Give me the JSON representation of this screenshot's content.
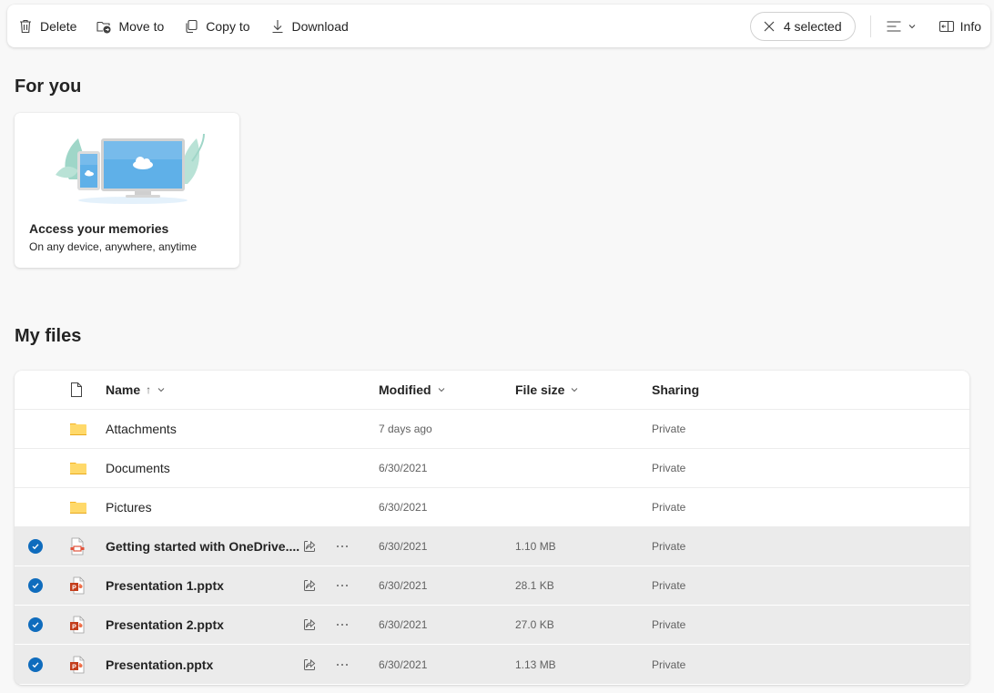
{
  "toolbar": {
    "delete_label": "Delete",
    "move_label": "Move to",
    "copy_label": "Copy to",
    "download_label": "Download",
    "selected_label": "4 selected",
    "info_label": "Info"
  },
  "for_you": {
    "title": "For you",
    "card": {
      "title": "Access your memories",
      "subtitle": "On any device, anywhere, anytime"
    }
  },
  "my_files": {
    "title": "My files",
    "columns": {
      "name": "Name",
      "sort_indicator": "↑",
      "modified": "Modified",
      "file_size": "File size",
      "sharing": "Sharing"
    },
    "rows": [
      {
        "name": "Attachments",
        "type": "folder",
        "modified": "7 days ago",
        "size": "",
        "sharing": "Private",
        "selected": false
      },
      {
        "name": "Documents",
        "type": "folder",
        "modified": "6/30/2021",
        "size": "",
        "sharing": "Private",
        "selected": false
      },
      {
        "name": "Pictures",
        "type": "folder",
        "modified": "6/30/2021",
        "size": "",
        "sharing": "Private",
        "selected": false
      },
      {
        "name": "Getting started with OneDrive....",
        "type": "pdf",
        "modified": "6/30/2021",
        "size": "1.10 MB",
        "sharing": "Private",
        "selected": true
      },
      {
        "name": "Presentation 1.pptx",
        "type": "pptx",
        "modified": "6/30/2021",
        "size": "28.1 KB",
        "sharing": "Private",
        "selected": true
      },
      {
        "name": "Presentation 2.pptx",
        "type": "pptx",
        "modified": "6/30/2021",
        "size": "27.0 KB",
        "sharing": "Private",
        "selected": true
      },
      {
        "name": "Presentation.pptx",
        "type": "pptx",
        "modified": "6/30/2021",
        "size": "1.13 MB",
        "sharing": "Private",
        "selected": true
      }
    ]
  },
  "colors": {
    "accent": "#0f6cbd",
    "folder": "#ffd96a",
    "pptx": "#c43e1c",
    "selected_row": "#ebebeb"
  }
}
